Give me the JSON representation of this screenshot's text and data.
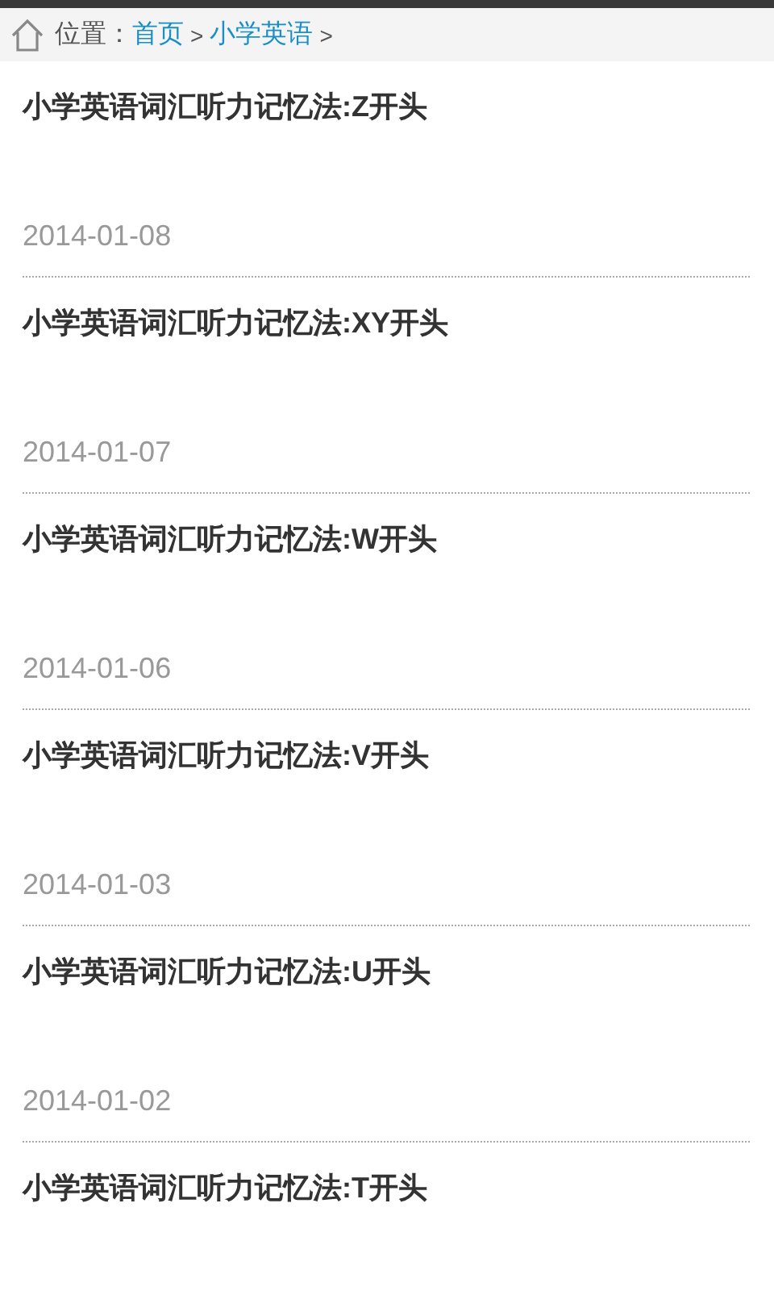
{
  "breadcrumb": {
    "label": "位置：",
    "links": [
      "首页",
      "小学英语"
    ],
    "separator": ">"
  },
  "articles": [
    {
      "title": "小学英语词汇听力记忆法:Z开头",
      "date": "2014-01-08"
    },
    {
      "title": "小学英语词汇听力记忆法:XY开头",
      "date": "2014-01-07"
    },
    {
      "title": "小学英语词汇听力记忆法:W开头",
      "date": "2014-01-06"
    },
    {
      "title": "小学英语词汇听力记忆法:V开头",
      "date": "2014-01-03"
    },
    {
      "title": "小学英语词汇听力记忆法:U开头",
      "date": "2014-01-02"
    },
    {
      "title": "小学英语词汇听力记忆法:T开头"
    }
  ]
}
